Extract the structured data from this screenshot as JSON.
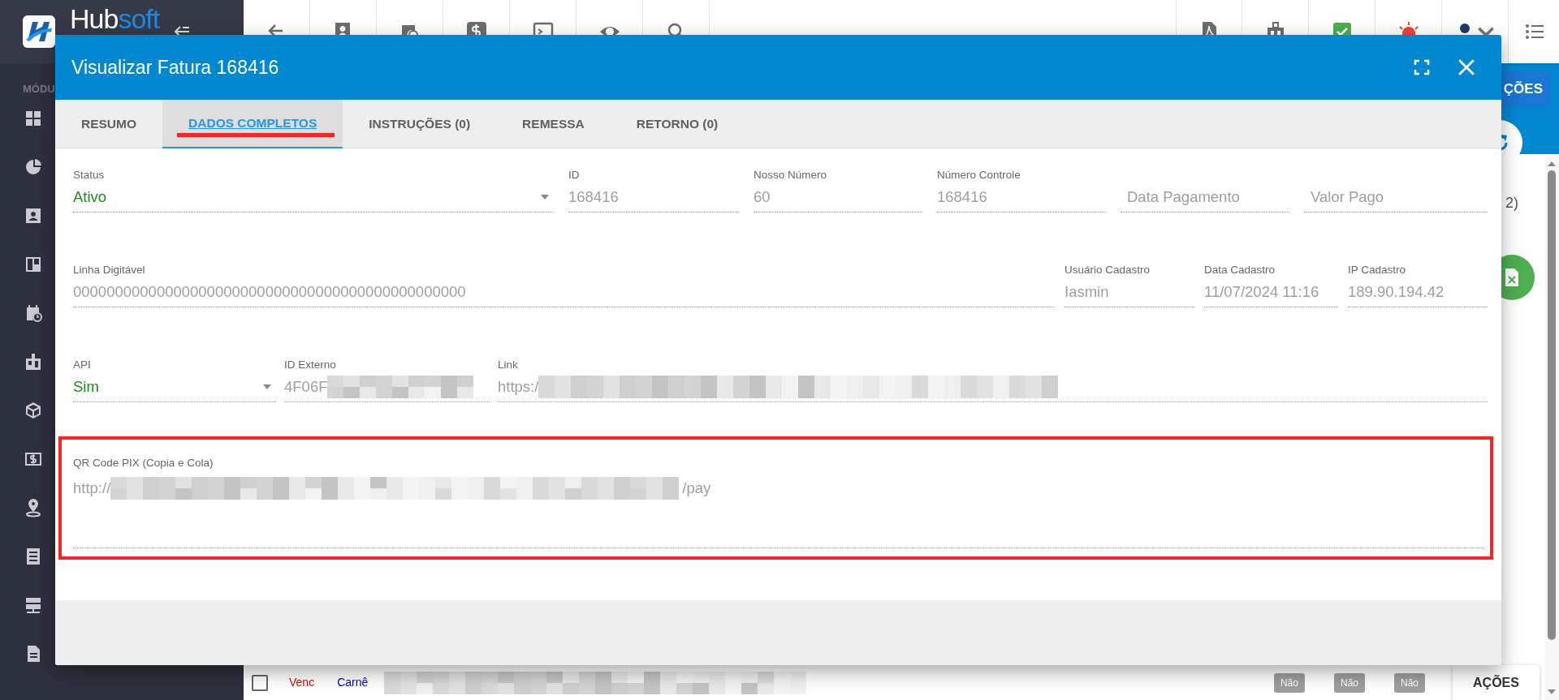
{
  "sidebar": {
    "brand": {
      "part_1": "Hub",
      "part_2": "soft"
    },
    "section_label": "MÓDU"
  },
  "background": {
    "actions_button": "ÇÕES",
    "count_text": "2)",
    "row": {
      "checked": false,
      "status": "Venc",
      "type": "Carnê",
      "flags": [
        "Não",
        "Não",
        "Não"
      ],
      "actions_button": "AÇÕES"
    }
  },
  "modal": {
    "title": "Visualizar Fatura 168416",
    "tabs": [
      {
        "label": "RESUMO",
        "selected": false,
        "highlighted": false
      },
      {
        "label": "DADOS COMPLETOS",
        "selected": true,
        "highlighted": true
      },
      {
        "label": "INSTRUÇÕES (0)",
        "selected": false,
        "highlighted": false
      },
      {
        "label": "REMESSA",
        "selected": false,
        "highlighted": false
      },
      {
        "label": "RETORNO (0)",
        "selected": false,
        "highlighted": false
      }
    ],
    "rows": [
      {
        "highlighted": false,
        "fields": [
          {
            "kind": "select",
            "label": "Status",
            "value": "Ativo"
          },
          {
            "kind": "text",
            "label": "ID",
            "value": "168416"
          },
          {
            "kind": "text",
            "label": "Nosso Número",
            "value": "60"
          },
          {
            "kind": "text",
            "label": "Número Controle",
            "value": "168416"
          },
          {
            "kind": "empty",
            "placeholder": "Data Pagamento"
          },
          {
            "kind": "empty",
            "placeholder": "Valor Pago"
          }
        ]
      },
      {
        "highlighted": false,
        "fields": [
          {
            "kind": "text",
            "label": "Linha Digitável",
            "value": "00000000000000000000000000000000000000000000000"
          },
          {
            "kind": "text",
            "label": "Usuário Cadastro",
            "value": "Iasmin"
          },
          {
            "kind": "text",
            "label": "Data Cadastro",
            "value": "11/07/2024 11:16"
          },
          {
            "kind": "text",
            "label": "IP Cadastro",
            "value": "189.90.194.42"
          }
        ]
      },
      {
        "highlighted": false,
        "fields": [
          {
            "kind": "select",
            "label": "API",
            "value": "Sim"
          },
          {
            "kind": "text",
            "label": "ID Externo",
            "value": "4F06F",
            "redacted": true
          },
          {
            "kind": "text",
            "label": "Link",
            "value": "https:/",
            "redacted": true
          }
        ]
      },
      {
        "highlighted": true,
        "fields": [
          {
            "kind": "textarea",
            "label": "QR Code PIX (Copia e Cola)",
            "value": "http://",
            "redacted": true,
            "value_end": "/pay"
          }
        ]
      }
    ]
  }
}
